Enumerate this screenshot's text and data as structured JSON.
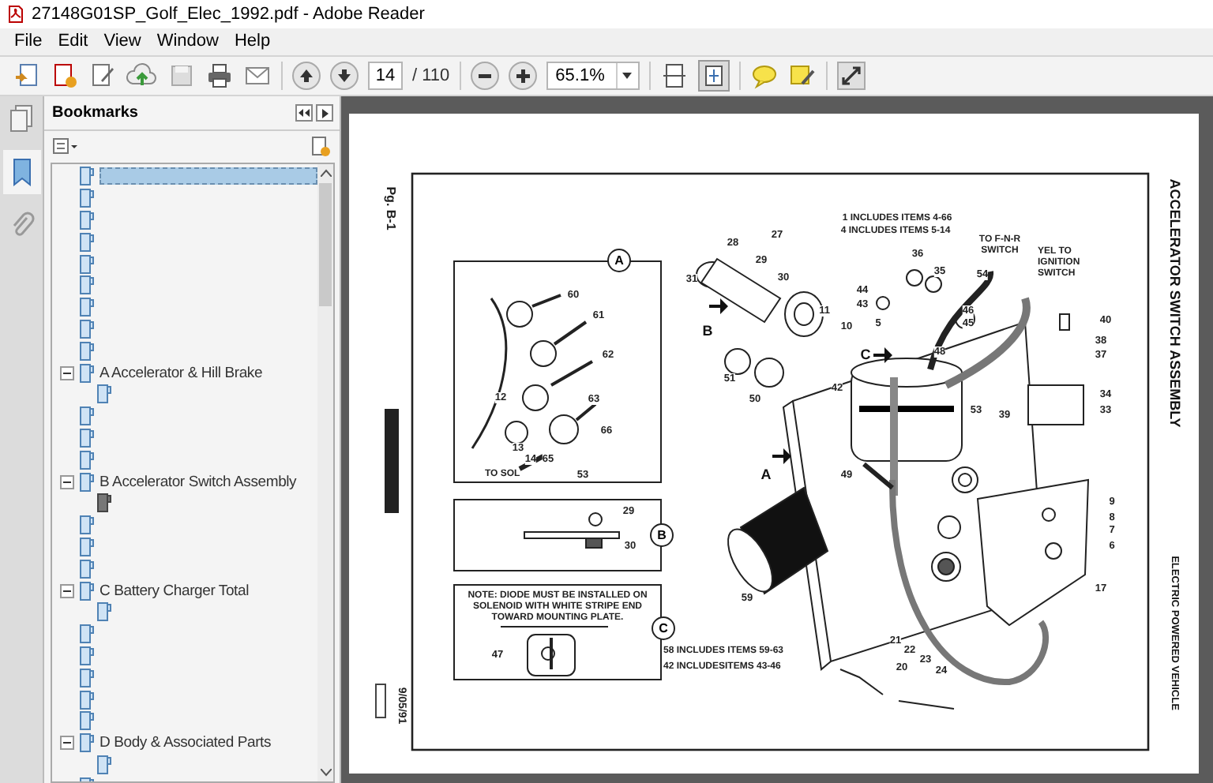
{
  "window": {
    "title": "27148G01SP_Golf_Elec_1992.pdf - Adobe Reader"
  },
  "menu": [
    "File",
    "Edit",
    "View",
    "Window",
    "Help"
  ],
  "toolbar": {
    "page_number": "14",
    "page_count": "/ 110",
    "zoom": "65.1%"
  },
  "bookmarks": {
    "title": "Bookmarks",
    "items": [
      {
        "selected": true
      },
      {
        "selected": false
      },
      {
        "selected": false
      },
      {
        "selected": false
      },
      {
        "selected": false
      },
      {
        "selected": false
      },
      {
        "selected": false
      },
      {
        "selected": false
      },
      {
        "selected": false
      },
      {
        "label": "A  Accelerator & Hill Brake",
        "selected": false,
        "expanded": true,
        "children": [
          {
            "selected": false,
            "current": false
          }
        ]
      },
      {
        "selected": false
      },
      {
        "selected": false
      },
      {
        "selected": false
      },
      {
        "label": "B  Accelerator Switch Assembly",
        "selected": false,
        "expanded": true,
        "children": [
          {
            "selected": false,
            "current": true
          }
        ]
      },
      {
        "selected": false
      },
      {
        "selected": false
      },
      {
        "selected": false
      },
      {
        "label": "C  Battery Charger Total",
        "selected": false,
        "expanded": true,
        "children": [
          {
            "selected": false,
            "current": false
          }
        ]
      },
      {
        "selected": false
      },
      {
        "selected": false
      },
      {
        "selected": false
      },
      {
        "selected": false
      },
      {
        "selected": false
      },
      {
        "label": "D  Body & Associated Parts",
        "selected": false,
        "expanded": true,
        "children": [
          {
            "selected": false,
            "current": false
          }
        ]
      },
      {
        "selected": false
      }
    ]
  },
  "page": {
    "page_label": "Pg. B-1",
    "title": "ACCELERATOR SWITCH ASSEMBLY",
    "subtitle": "ELECTRIC POWERED VEHICLE",
    "date": "9/05/91",
    "notes": [
      "1 INCLUDES ITEMS 4-66",
      "4 INCLUDES ITEMS 5-14",
      "TO F-N-R SWITCH",
      "YEL TO IGNITION SWITCH",
      "58 INCLUDES ITEMS 59-63",
      "42 INCLUDESITEMS 43-46",
      "TO SOL",
      "NOTE: DIODE MUST BE INSTALLED ON SOLENOID WITH WHITE STRIPE END TOWARD MOUNTING PLATE."
    ],
    "detail_markers": [
      "A",
      "B",
      "C"
    ],
    "view_arrows": [
      "B",
      "C",
      "A"
    ],
    "callouts": [
      "60",
      "61",
      "62",
      "12",
      "13",
      "14",
      "63",
      "66",
      "65",
      "53",
      "28",
      "29",
      "27",
      "31",
      "30",
      "11",
      "10",
      "51",
      "50",
      "36",
      "35",
      "44",
      "43",
      "5",
      "46",
      "45",
      "48",
      "42",
      "54",
      "40",
      "38",
      "37",
      "53",
      "39",
      "34",
      "33",
      "49",
      "9",
      "8",
      "7",
      "6",
      "17",
      "21",
      "22",
      "23",
      "24",
      "20",
      "59",
      "29",
      "30",
      "47"
    ]
  }
}
